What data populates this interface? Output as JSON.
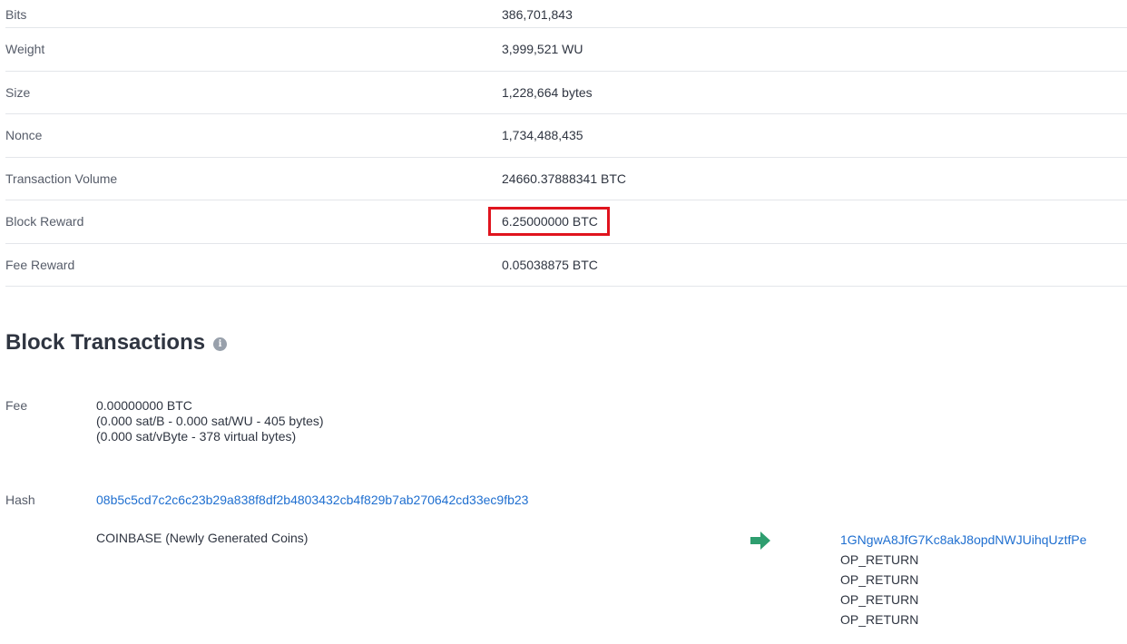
{
  "details": [
    {
      "label": "Bits",
      "value": "386,701,843"
    },
    {
      "label": "Weight",
      "value": "3,999,521 WU"
    },
    {
      "label": "Size",
      "value": "1,228,664 bytes"
    },
    {
      "label": "Nonce",
      "value": "1,734,488,435"
    },
    {
      "label": "Transaction Volume",
      "value": "24660.37888341 BTC"
    },
    {
      "label": "Block Reward",
      "value": "6.25000000 BTC"
    },
    {
      "label": "Fee Reward",
      "value": "0.05038875 BTC"
    }
  ],
  "section": {
    "title": "Block Transactions",
    "info_icon": "info-icon"
  },
  "transaction": {
    "fee_label": "Fee",
    "fee_btc": "0.00000000 BTC",
    "fee_detail_1": "(0.000 sat/B - 0.000 sat/WU - 405 bytes)",
    "fee_detail_2": "(0.000 sat/vByte - 378 virtual bytes)",
    "hash_label": "Hash",
    "hash": "08b5c5cd7c2c6c23b29a838f8df2b4803432cb4f829b7ab270642cd33ec9fb23",
    "input": "COINBASE (Newly Generated Coins)",
    "arrow_icon": "arrow-right-icon",
    "outputs": [
      {
        "text": "1GNgwA8JfG7Kc8akJ8opdNWJUihqUztfPe",
        "link": true
      },
      {
        "text": "OP_RETURN",
        "link": false
      },
      {
        "text": "OP_RETURN",
        "link": false
      },
      {
        "text": "OP_RETURN",
        "link": false
      },
      {
        "text": "OP_RETURN",
        "link": false
      }
    ]
  },
  "colors": {
    "link": "#1f6fd0",
    "arrow": "#2e9e6f",
    "highlight": "#e0141e"
  }
}
